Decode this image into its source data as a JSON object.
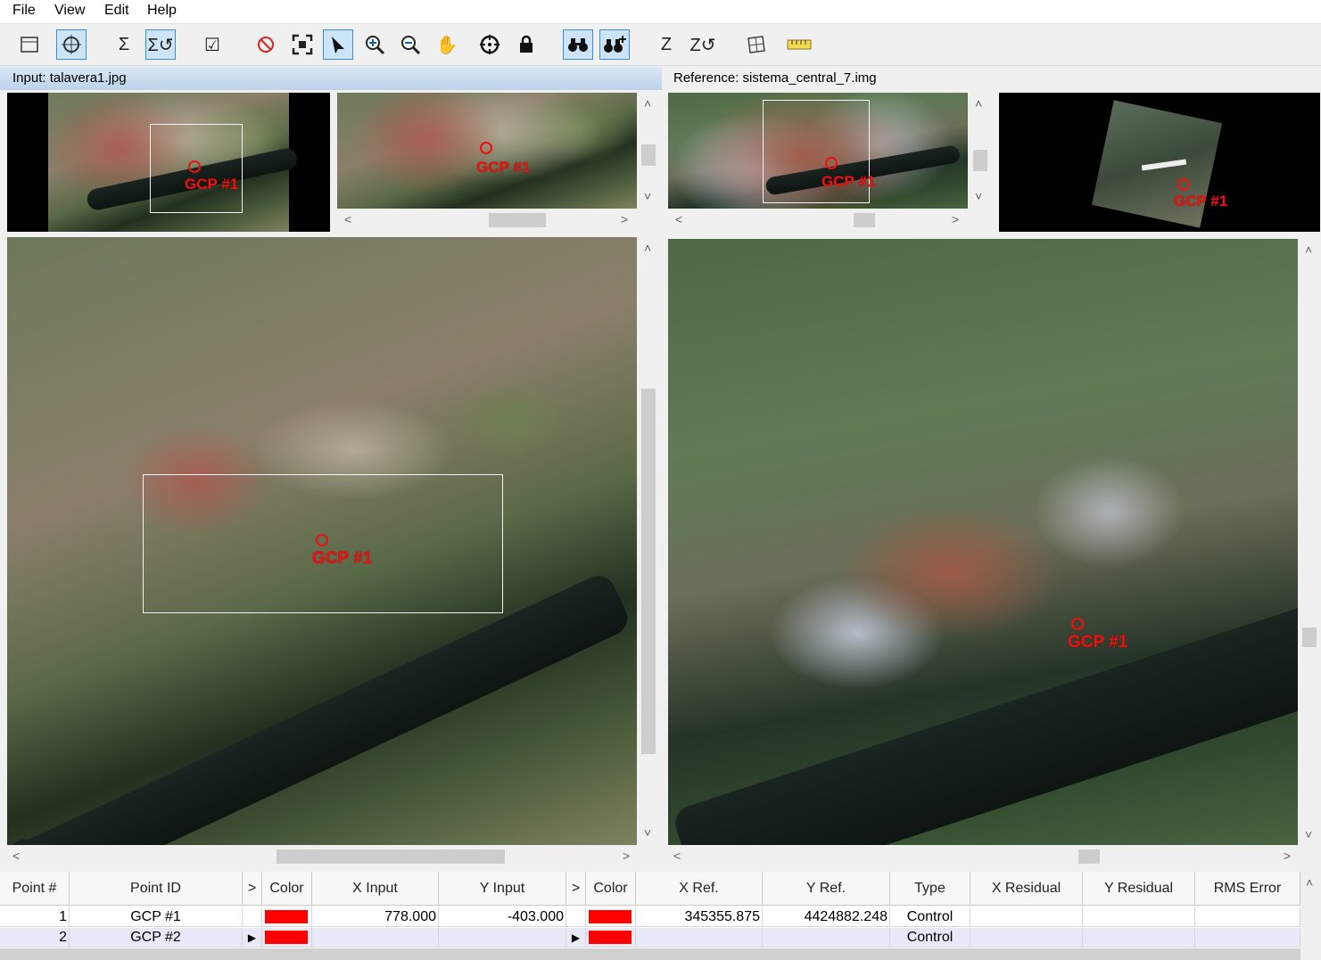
{
  "menu": [
    "File",
    "View",
    "Edit",
    "Help"
  ],
  "toolbar": {
    "icons": [
      "select-rect-icon",
      "gcp-tool-icon",
      "sigma-icon",
      "sigma-auto-icon",
      "check-icon",
      "points-icon",
      "fit-extent-icon",
      "pointer-icon",
      "zoom-in-icon",
      "zoom-out-icon",
      "pan-icon",
      "crosshair-icon",
      "lock-icon",
      "binoculars-icon",
      "binoculars-add-icon",
      "z-icon",
      "z-auto-icon",
      "grid-transform-icon",
      "ruler-icon"
    ]
  },
  "input_panel": {
    "title": "Input: talavera1.jpg",
    "gcp_label": "GCP #1"
  },
  "reference_panel": {
    "title": "Reference: sistema_central_7.img",
    "gcp_label": "GCP #1"
  },
  "table": {
    "headers": [
      "Point #",
      "Point ID",
      ">",
      "Color",
      "X Input",
      "Y Input",
      ">",
      "Color",
      "X Ref.",
      "Y Ref.",
      "Type",
      "X Residual",
      "Y Residual",
      "RMS Error"
    ],
    "rows": [
      {
        "num": "1",
        "id": "GCP #1",
        "arrow1": "",
        "x_input": "778.000",
        "y_input": "-403.000",
        "arrow2": "",
        "x_ref": "345355.875",
        "y_ref": "4424882.248",
        "type": "Control"
      },
      {
        "num": "2",
        "id": "GCP #2",
        "arrow1": "▶",
        "x_input": "",
        "y_input": "",
        "arrow2": "▶",
        "x_ref": "",
        "y_ref": "",
        "type": "Control"
      }
    ],
    "color_swatch": "#ff0000"
  },
  "scroll": {
    "left": "<",
    "right": ">",
    "up": "^",
    "down": "v"
  }
}
